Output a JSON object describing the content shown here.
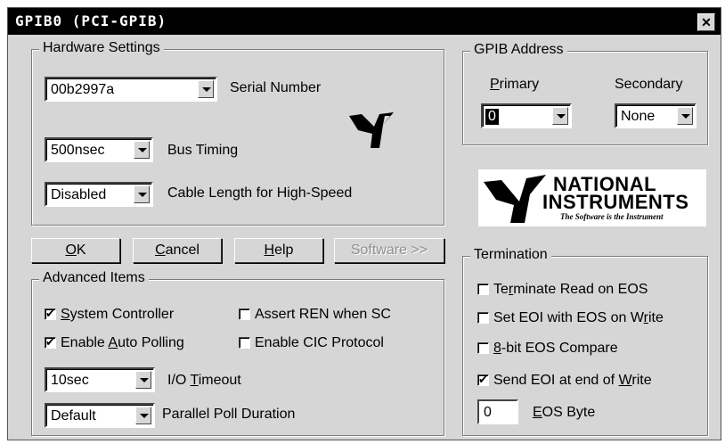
{
  "window": {
    "title": "GPIB0 (PCI-GPIB)",
    "close_glyph": "✕"
  },
  "hardware": {
    "legend": "Hardware Settings",
    "serial": {
      "value": "00b2997a",
      "label": "Serial Number"
    },
    "bus_timing": {
      "value": "500nsec",
      "label": "Bus Timing"
    },
    "cable_length": {
      "value": "Disabled",
      "label": "Cable Length for High-Speed"
    }
  },
  "gpib_address": {
    "legend": "GPIB Address",
    "primary": {
      "label_pre": "",
      "label_u": "P",
      "label_post": "rimary",
      "value": "0"
    },
    "secondary": {
      "label": "Secondary",
      "value": "None"
    }
  },
  "logo": {
    "line1": "NATIONAL",
    "line2": "INSTRUMENTS",
    "tagline": "The Software is the Instrument"
  },
  "buttons": {
    "ok": {
      "u": "O",
      "rest": "K"
    },
    "cancel": {
      "u": "C",
      "rest": "ancel"
    },
    "help": {
      "u": "H",
      "rest": "elp"
    },
    "software": "Software >>"
  },
  "advanced": {
    "legend": "Advanced Items",
    "system_controller": {
      "pre": "",
      "u": "S",
      "post": "ystem Controller",
      "checked": true
    },
    "assert_ren": {
      "pre": "Assert REN when SC",
      "u": "",
      "post": "",
      "checked": false
    },
    "auto_polling": {
      "pre": "Enable ",
      "u": "A",
      "post": "uto Polling",
      "checked": true
    },
    "cic_protocol": {
      "pre": "Enable CIC Protocol",
      "u": "",
      "post": "",
      "checked": false
    },
    "timeout": {
      "value": "10sec",
      "label_pre": "I/O ",
      "label_u": "T",
      "label_post": "imeout"
    },
    "poll_duration": {
      "value": "Default",
      "label": "Parallel Poll Duration"
    }
  },
  "termination": {
    "legend": "Termination",
    "terminate_read": {
      "pre": "Te",
      "u": "r",
      "post": "minate Read on EOS",
      "checked": false
    },
    "set_eoi": {
      "pre": "Set EOI with EOS on W",
      "u": "r",
      "post": "ite",
      "checked": false
    },
    "eight_bit": {
      "pre": "",
      "u": "8",
      "post": "-bit EOS Compare",
      "checked": false
    },
    "send_eoi": {
      "pre": "Send EOI at end of ",
      "u": "W",
      "post": "rite",
      "checked": true
    },
    "eos_byte": {
      "value": "0",
      "label_pre": "",
      "label_u": "E",
      "label_post": "OS Byte"
    }
  }
}
